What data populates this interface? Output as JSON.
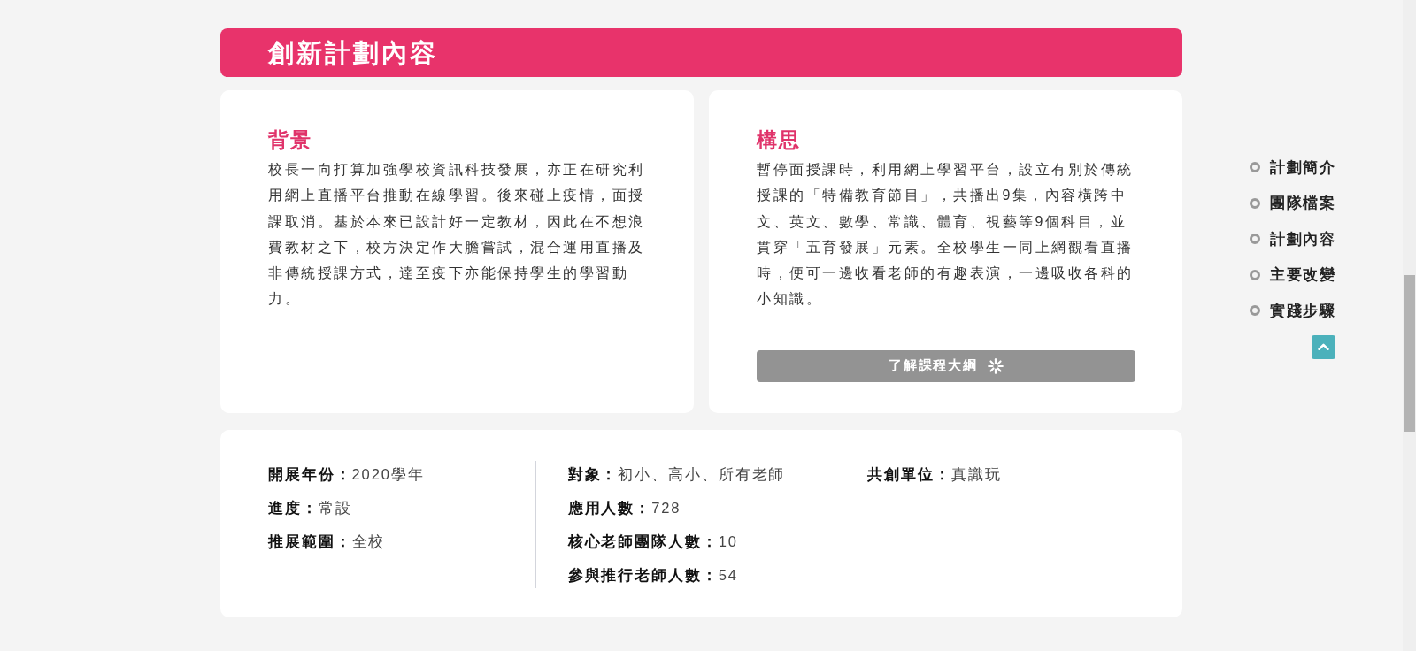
{
  "section_header": {
    "title": "創新計劃內容"
  },
  "cards": [
    {
      "heading": "背景",
      "body": "校長一向打算加強學校資訊科技發展，亦正在研究利用網上直播平台推動在線學習。後來碰上疫情，面授課取消。基於本來已設計好一定教材，因此在不想浪費教材之下，校方決定作大膽嘗試，混合運用直播及非傳統授課方式，達至疫下亦能保持學生的學習動力。"
    },
    {
      "heading": "構思",
      "body": "暫停面授課時，利用網上學習平台，設立有別於傳統授課的「特備教育節目」，共播出9集，內容橫跨中文、英文、數學、常識、體育、視藝等9個科目，並貫穿「五育發展」元素。全校學生一同上網觀看直播時，便可一邊收看老師的有趣表演，一邊吸收各科的小知識。",
      "button": {
        "label": "了解課程大綱"
      }
    }
  ],
  "details": {
    "columns": [
      {
        "fields": [
          {
            "label": "開展年份：",
            "value": "2020學年"
          },
          {
            "label": "進度：",
            "value": "常設"
          },
          {
            "label": "推展範圍：",
            "value": "全校"
          }
        ]
      },
      {
        "fields": [
          {
            "label": "對象：",
            "value": "初小、高小、所有老師"
          },
          {
            "label": "應用人數：",
            "value": "728"
          },
          {
            "label": "核心老師團隊人數：",
            "value": "10"
          },
          {
            "label": "參與推行老師人數：",
            "value": "54"
          }
        ]
      },
      {
        "fields": [
          {
            "label": "共創單位：",
            "value": "真識玩"
          }
        ]
      }
    ]
  },
  "side_nav": {
    "items": [
      {
        "label": "計劃簡介"
      },
      {
        "label": "團隊檔案"
      },
      {
        "label": "計劃內容"
      },
      {
        "label": "主要改變"
      },
      {
        "label": "實踐步驟"
      }
    ]
  }
}
